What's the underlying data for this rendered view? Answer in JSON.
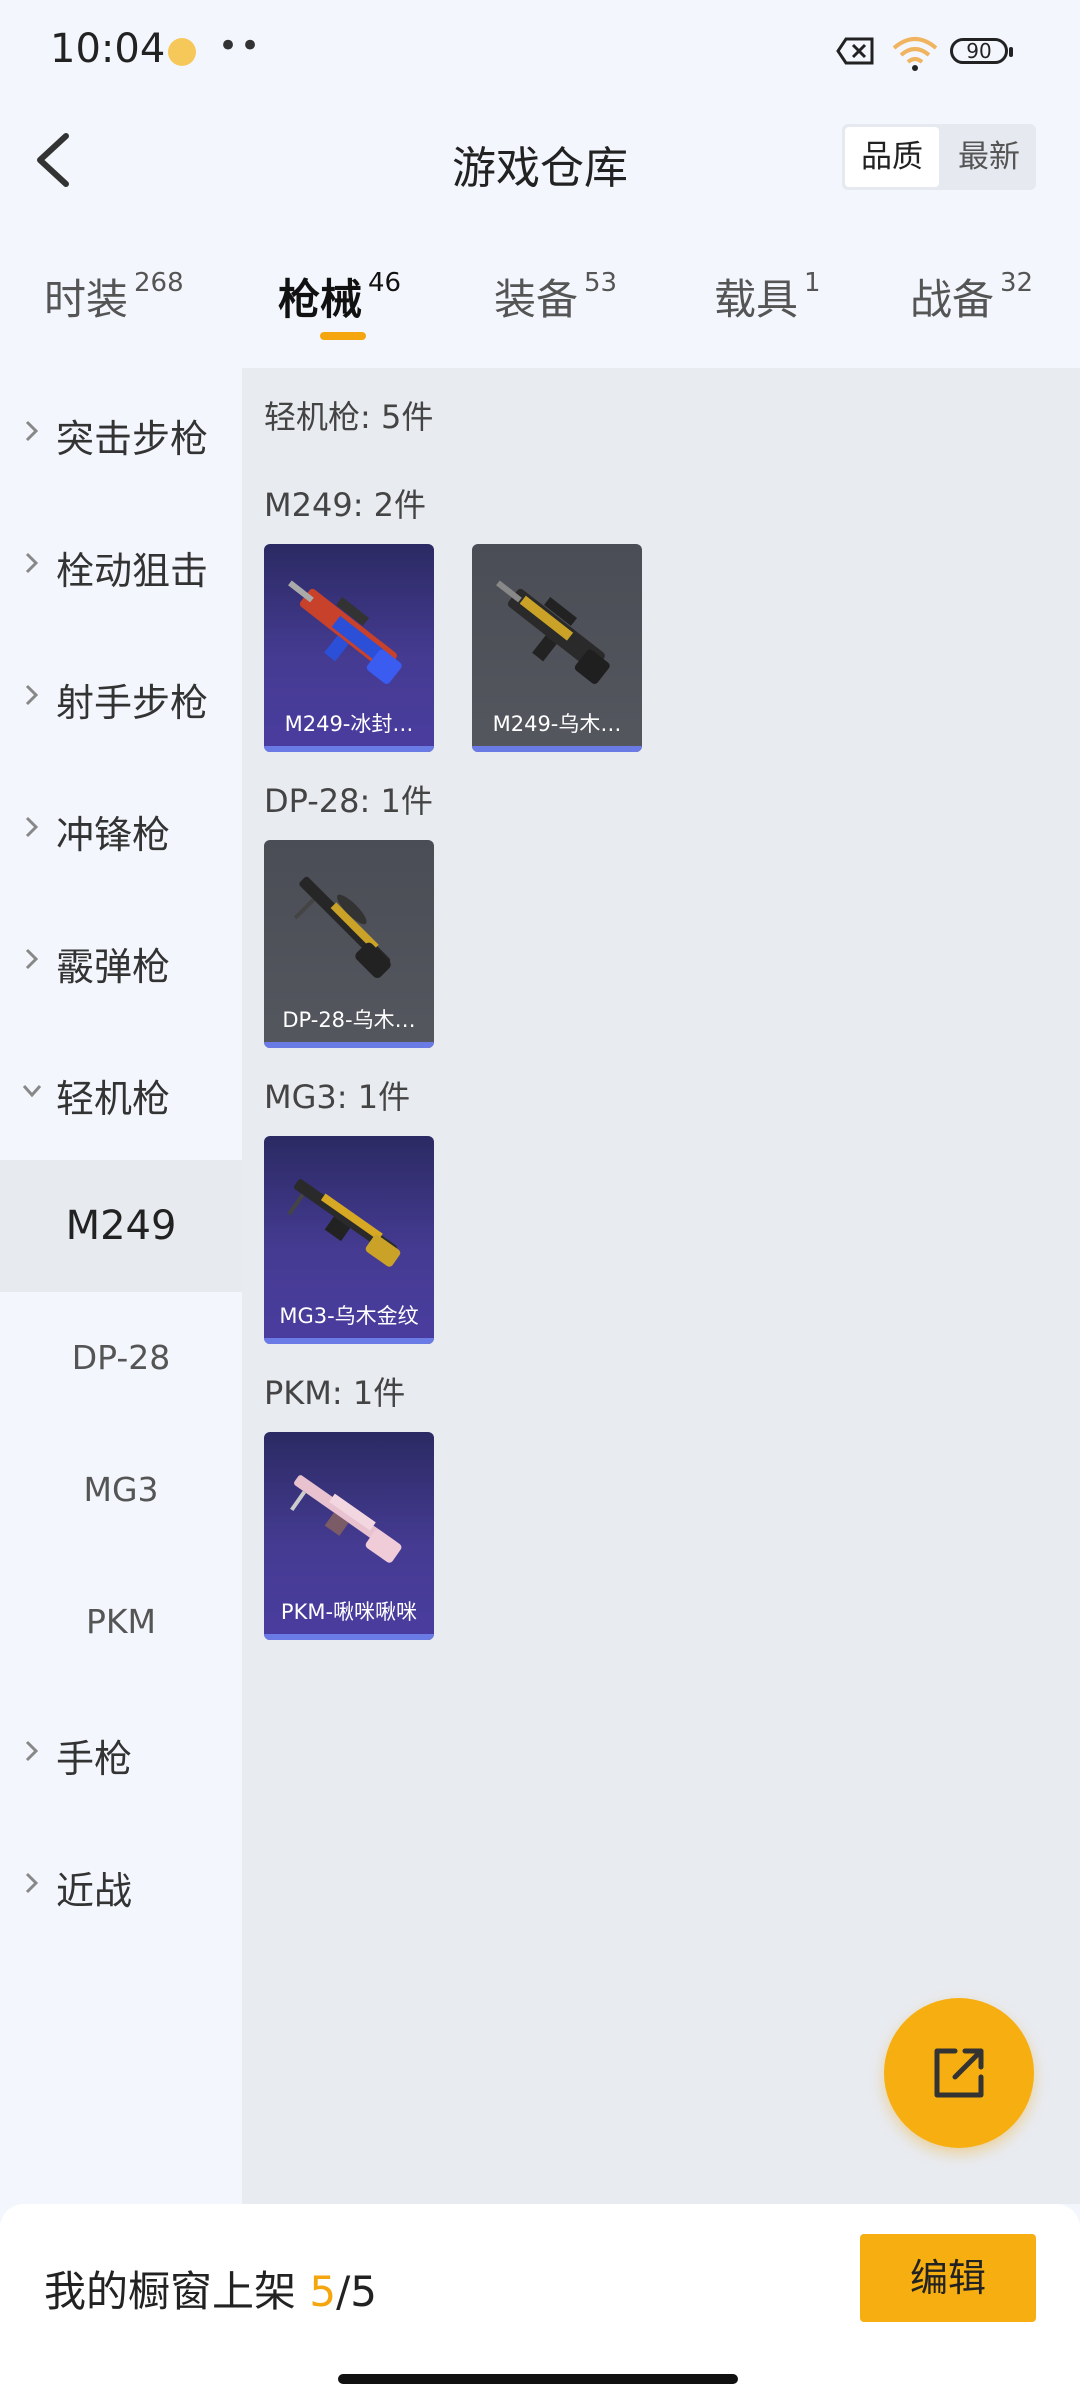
{
  "status": {
    "time": "10:04",
    "dots": "••",
    "battery": "90"
  },
  "header": {
    "title": "游戏仓库",
    "sort_quality": "品质",
    "sort_latest": "最新"
  },
  "tabs": [
    {
      "label": "时装",
      "count": "268"
    },
    {
      "label": "枪械",
      "count": "46"
    },
    {
      "label": "装备",
      "count": "53"
    },
    {
      "label": "载具",
      "count": "1"
    },
    {
      "label": "战备",
      "count": "32"
    }
  ],
  "sidebar": {
    "categories": [
      "突击步枪",
      "栓动狙击",
      "射手步枪",
      "冲锋枪",
      "霰弹枪",
      "轻机枪",
      "手枪",
      "近战"
    ],
    "subitems": [
      "M249",
      "DP-28",
      "MG3",
      "PKM"
    ]
  },
  "content": {
    "summary": "轻机枪: 5件",
    "groups": [
      {
        "title": "M249: 2件",
        "items": [
          {
            "name": "M249-冰封…",
            "rarity": "purple"
          },
          {
            "name": "M249-乌木…",
            "rarity": "gray"
          }
        ]
      },
      {
        "title": "DP-28: 1件",
        "items": [
          {
            "name": "DP-28-乌木…",
            "rarity": "gray"
          }
        ]
      },
      {
        "title": "MG3: 1件",
        "items": [
          {
            "name": "MG3-乌木金纹",
            "rarity": "purple"
          }
        ]
      },
      {
        "title": "PKM: 1件",
        "items": [
          {
            "name": "PKM-啾咪啾咪",
            "rarity": "purple"
          }
        ]
      }
    ]
  },
  "bottom": {
    "label": "我的橱窗上架",
    "current": "5",
    "sep": "/",
    "total": "5",
    "edit_label": "编辑"
  },
  "colors": {
    "accent": "#f6ae10",
    "purple_card": "#453b92",
    "gray_card": "#55575f",
    "rarity_bar": "#6a7be6"
  },
  "icons": {
    "fab": "external-link-icon",
    "back": "back-arrow-icon"
  }
}
